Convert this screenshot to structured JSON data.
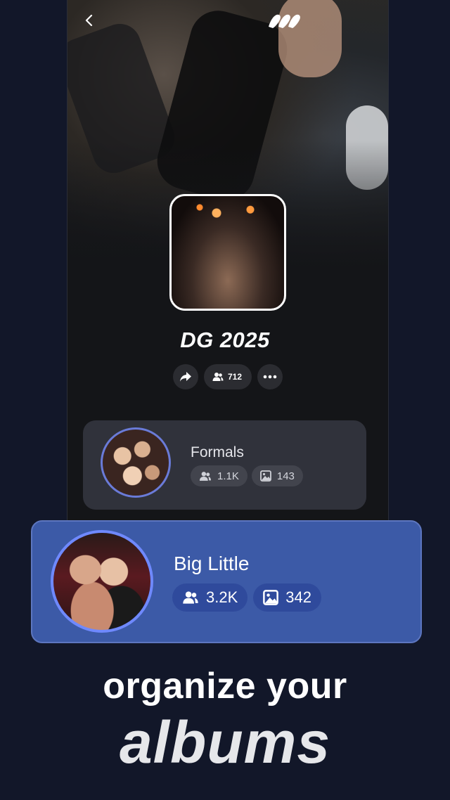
{
  "colors": {
    "background": "#121729",
    "card_dark": "#30323b",
    "card_highlight": "#3c5aa7",
    "avatar_ring": "#6f89ff"
  },
  "header": {
    "back_icon": "chevron-left-icon",
    "logo_icon": "app-logo-icon"
  },
  "album": {
    "title": "DG 2025",
    "members_count": "712",
    "share_icon": "share-icon",
    "more_icon": "more-dots-icon"
  },
  "sub_albums": [
    {
      "name": "Formals",
      "members": "1.1K",
      "photos": "143"
    },
    {
      "name": "Big Little",
      "members": "3.2K",
      "photos": "342"
    }
  ],
  "tagline": {
    "line1": "organize your",
    "line2": "albums"
  }
}
